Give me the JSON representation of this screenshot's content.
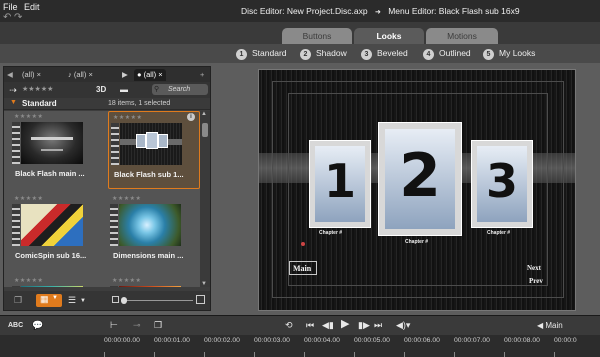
{
  "menu": {
    "file": "File",
    "edit": "Edit"
  },
  "breadcrumb": {
    "disc_editor": "Disc Editor: New Project.Disc.axp",
    "separator": "➜",
    "menu_editor": "Menu Editor: Black Flash sub 16x9"
  },
  "tabs": [
    {
      "label": "Buttons"
    },
    {
      "label": "Looks"
    },
    {
      "label": "Motions"
    }
  ],
  "looks": [
    {
      "num": "1",
      "label": "Standard"
    },
    {
      "num": "2",
      "label": "Shadow"
    },
    {
      "num": "3",
      "label": "Beveled"
    },
    {
      "num": "4",
      "label": "Outlined"
    },
    {
      "num": "5",
      "label": "My Looks"
    }
  ],
  "library": {
    "tabs": [
      {
        "label": "(all)"
      },
      {
        "label": "(all)"
      },
      {
        "label": "(all)"
      }
    ],
    "tab_close": "×",
    "mode_3d": "3D",
    "search_placeholder": "Search",
    "section": "Standard",
    "count_text": "18 items, 1 selected",
    "stars": "★★★★★",
    "items": [
      {
        "title": "Black Flash main ..."
      },
      {
        "title": "Black Flash sub 1..."
      },
      {
        "title": "ComicSpin sub 16..."
      },
      {
        "title": "Dimensions main ..."
      },
      {
        "title": ""
      },
      {
        "title": ""
      }
    ]
  },
  "preview": {
    "buttons": [
      {
        "num": "1",
        "label": "Chapter #"
      },
      {
        "num": "2",
        "label": "Chapter #"
      },
      {
        "num": "3",
        "label": "Chapter #"
      }
    ],
    "main": "Main",
    "next": "Next",
    "prev": "Prev"
  },
  "timeline": {
    "abc": "ABC",
    "main_label": "Main",
    "ticks": [
      "00:00:00.00",
      "00:00:01.00",
      "00:00:02.00",
      "00:00:03.00",
      "00:00:04.00",
      "00:00:05.00",
      "00:00:06.00",
      "00:00:07.00",
      "00:00:08.00",
      "00:00:0"
    ]
  },
  "colors": {
    "accent": "#e07b1d",
    "background": "#5d5d5d"
  }
}
